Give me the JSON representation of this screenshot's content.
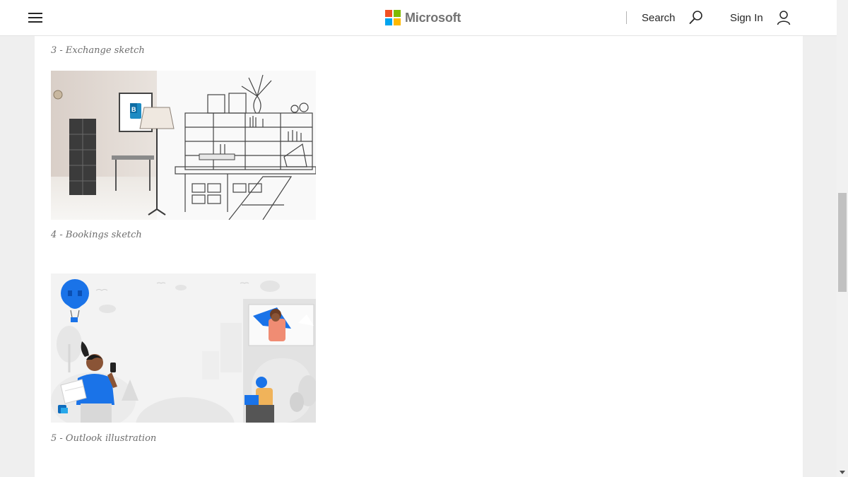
{
  "header": {
    "brand_name": "Microsoft",
    "search_label": "Search",
    "signin_label": "Sign In",
    "logo_colors": [
      "#f25022",
      "#7fba00",
      "#00a4ef",
      "#ffb900"
    ],
    "icons": {
      "menu": "hamburger-icon",
      "search": "search-icon",
      "user": "user-icon"
    }
  },
  "captions": [
    "3 - Exchange sketch",
    "4 - Bookings sketch",
    "5 - Outlook illustration"
  ],
  "accent_colors": {
    "bookings": "#1e8bc3",
    "outlook_blue": "#1a73e8",
    "outlook_coral": "#f08c73"
  }
}
